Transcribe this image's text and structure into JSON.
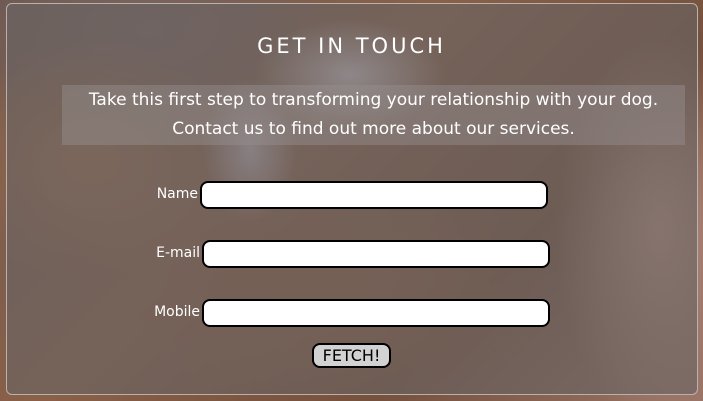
{
  "contact": {
    "title": "GET IN TOUCH",
    "intro_line1": "Take this first step to transforming your relationship with your dog.",
    "intro_line2": "Contact us to find out more about our services."
  },
  "form": {
    "name_label": "Name",
    "name_value": "",
    "email_label": "E-mail",
    "email_value": "",
    "mobile_label": "Mobile",
    "mobile_value": "",
    "submit_label": "FETCH!"
  }
}
